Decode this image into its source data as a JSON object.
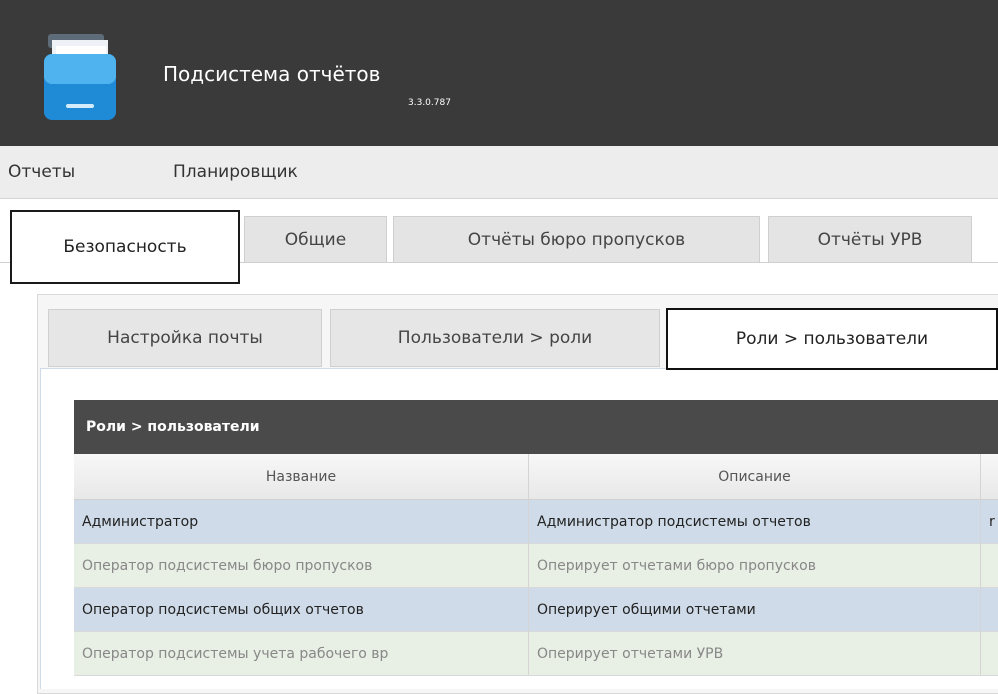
{
  "header": {
    "title": "Подсистема отчётов",
    "version": "3.3.0.787"
  },
  "menu": [
    "Отчеты",
    "Планировщик"
  ],
  "tabs": [
    "Безопасность",
    "Общие",
    "Отчёты бюро пропусков",
    "Отчёты УРВ"
  ],
  "subtabs": [
    "Настройка почты",
    "Пользователи > роли",
    "Роли > пользователи"
  ],
  "grid": {
    "title": "Роли > пользователи",
    "columns": [
      "Название",
      "Описание"
    ],
    "rows": [
      {
        "name": "Администратор",
        "desc": "Администратор подсистемы отчетов",
        "extra": "r"
      },
      {
        "name": "Оператор подсистемы бюро пропусков",
        "desc": "Оперирует отчетами бюро пропусков",
        "extra": ""
      },
      {
        "name": "Оператор подсистемы общих отчетов",
        "desc": "Оперирует общими отчетами",
        "extra": ""
      },
      {
        "name": "Оператор подсистемы учета рабочего вр",
        "desc": "Оперирует отчетами УРВ",
        "extra": ""
      }
    ]
  }
}
